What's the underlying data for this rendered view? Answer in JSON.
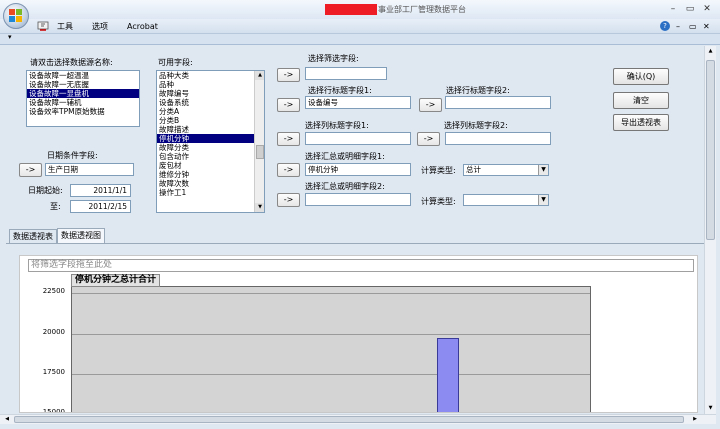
{
  "titlebar": {
    "title_suffix": "事业部工厂管理数据平台",
    "redacted_color": "#ee1c24",
    "help_glyph": "?",
    "minimize_glyph": "–",
    "restore_glyph": "▭",
    "close_glyph": "✕"
  },
  "menubar": {
    "items": [
      "工具",
      "选项",
      "Acrobat"
    ],
    "right_help": "?",
    "right_min": "–",
    "right_restore": "▭",
    "right_close": "✕",
    "qat_glyph": "▾"
  },
  "form": {
    "source_label": "请双击选择数据源名称:",
    "sources": [
      "设备故障一超温温",
      "设备故障一无底握",
      "设备故障一显盘机",
      "设备故障一辅机",
      "设备效率TPM原始数据"
    ],
    "selected_source_index": 2,
    "fields_label": "可用字段:",
    "fields": [
      "品种大类",
      "品种",
      "故障编号",
      "设备系统",
      "分类A",
      "分类B",
      "故障描述",
      "停机分钟",
      "故障分类",
      "包含动作",
      "废包材",
      "维修分钟",
      "故障次数",
      "操作工1"
    ],
    "selected_field_index": 7,
    "date_condition_label": "日期条件字段:",
    "date_field_value": "生产日期",
    "date_start_label": "日期起始:",
    "date_start_value": "2011/1/1",
    "date_end_label": "至:",
    "date_end_value": "2011/2/15",
    "arrow_label": "->",
    "filter_field_label": "选择筛选字段:",
    "filter_field_value": "",
    "row_title1_label": "选择行标题字段1:",
    "row_title1_value": "设备编号",
    "row_title2_label": "选择行标题字段2:",
    "row_title2_value": "",
    "col_title1_label": "选择列标题字段1:",
    "col_title1_value": "",
    "col_title2_label": "选择列标题字段2:",
    "col_title2_value": "",
    "sum1_label": "选择汇总或明细字段1:",
    "sum1_value": "停机分钟",
    "sum2_label": "选择汇总或明细字段2:",
    "sum2_value": "",
    "calc_type_label": "计算类型:",
    "calc_type1_value": "总计",
    "calc_type2_value": "",
    "confirm_button": "确认(Q)",
    "clear_button": "清空",
    "export_button": "导出透视表"
  },
  "tabs": [
    "数据透视表",
    "数据透视图"
  ],
  "active_tab_index": 1,
  "pivot": {
    "filter_drop_hint": "将筛选字段拖至此处",
    "data_field_label": "停机分钟之总计合计"
  },
  "chart_data": {
    "type": "bar",
    "title": "",
    "ylabel": "",
    "xlabel": "",
    "y_ticks": [
      22500,
      20000,
      17500,
      15000
    ],
    "ylim_visible": [
      14800,
      22900
    ],
    "visible_bars": [
      {
        "value": 19700
      }
    ],
    "bar_color": "#8b8bf2",
    "grid": true
  }
}
